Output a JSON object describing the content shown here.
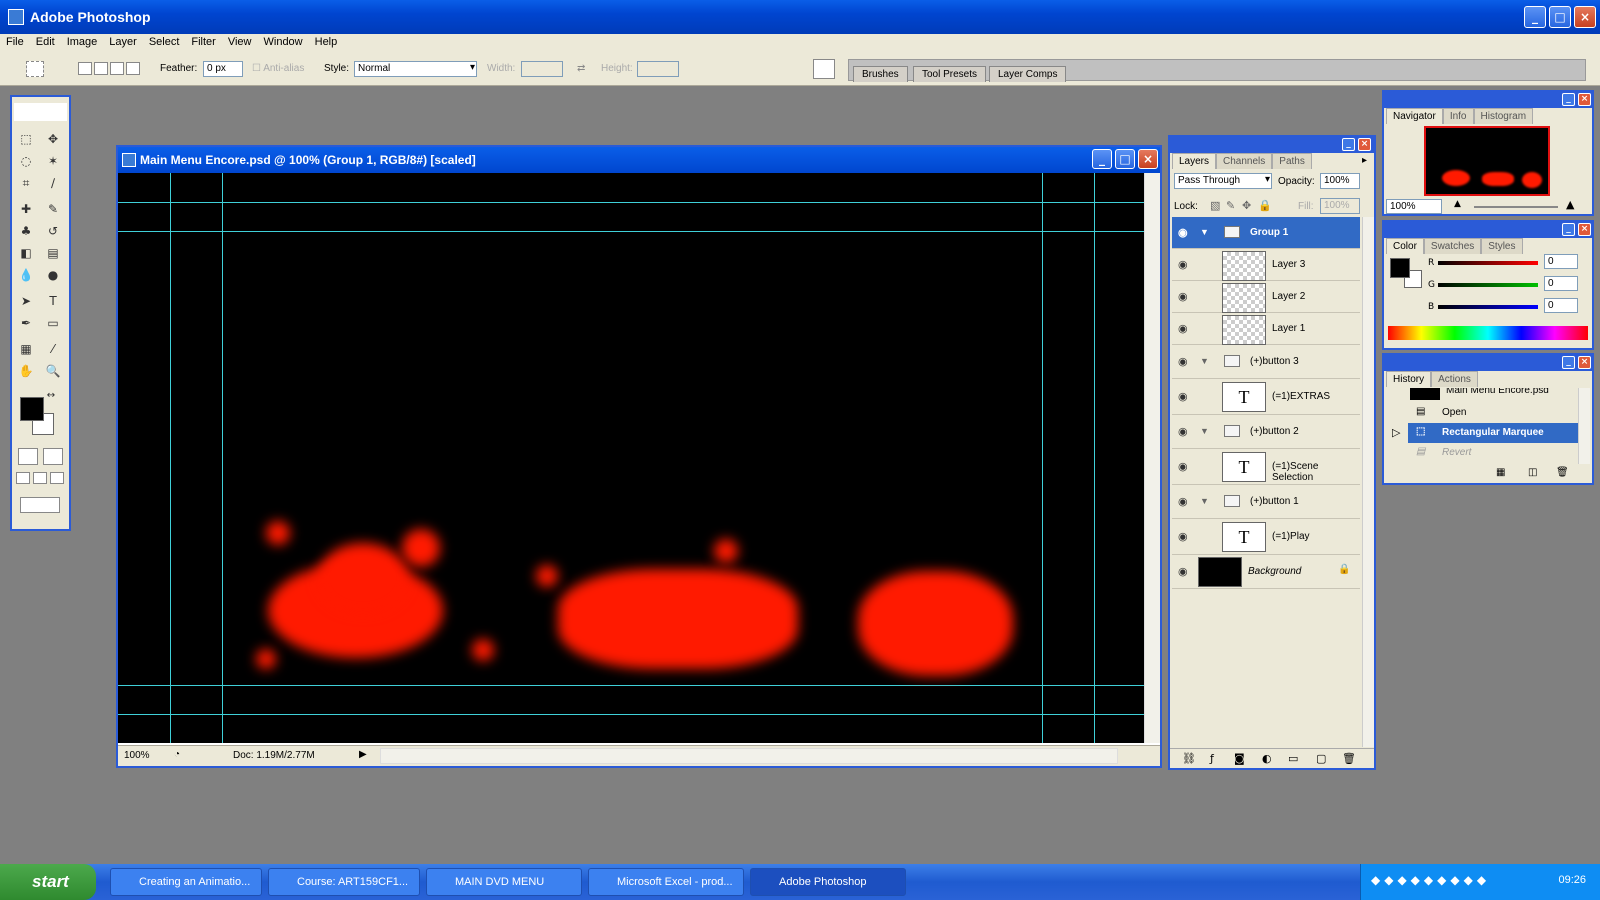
{
  "app": {
    "title": "Adobe Photoshop"
  },
  "menu": [
    "File",
    "Edit",
    "Image",
    "Layer",
    "Select",
    "Filter",
    "View",
    "Window",
    "Help"
  ],
  "options": {
    "feather_label": "Feather:",
    "feather_value": "0 px",
    "antialias_label": "Anti-alias",
    "style_label": "Style:",
    "style_value": "Normal",
    "width_label": "Width:",
    "height_label": "Height:"
  },
  "palette_well": [
    "Brushes",
    "Tool Presets",
    "Layer Comps"
  ],
  "document": {
    "title": "Main Menu Encore.psd @ 100% (Group 1, RGB/8#) [scaled]",
    "zoom": "100%",
    "doc_info": "Doc: 1.19M/2.77M"
  },
  "layers_panel": {
    "tabs": [
      "Layers",
      "Channels",
      "Paths"
    ],
    "blend_mode": "Pass Through",
    "opacity_label": "Opacity:",
    "opacity_value": "100%",
    "lock_label": "Lock:",
    "fill_label": "Fill:",
    "fill_value": "100%",
    "rows": [
      {
        "name": "Group 1",
        "kind": "group",
        "selected": true
      },
      {
        "name": "Layer 3",
        "kind": "layer"
      },
      {
        "name": "Layer 2",
        "kind": "layer"
      },
      {
        "name": "Layer 1",
        "kind": "layer"
      },
      {
        "name": "(+)button 3",
        "kind": "group"
      },
      {
        "name": "(=1)EXTRAS",
        "kind": "text"
      },
      {
        "name": "(+)button 2",
        "kind": "group"
      },
      {
        "name": "(=1)Scene Selection",
        "kind": "text"
      },
      {
        "name": "(+)button 1",
        "kind": "group"
      },
      {
        "name": "(=1)Play",
        "kind": "text"
      },
      {
        "name": "Background",
        "kind": "background"
      }
    ],
    "text_thumb": "T"
  },
  "navigator_panel": {
    "tabs": [
      "Navigator",
      "Info",
      "Histogram"
    ],
    "zoom": "100%"
  },
  "color_panel": {
    "tabs": [
      "Color",
      "Swatches",
      "Styles"
    ],
    "channels": [
      {
        "label": "R",
        "value": "0",
        "color": "#ff0000"
      },
      {
        "label": "G",
        "value": "0",
        "color": "#00c000"
      },
      {
        "label": "B",
        "value": "0",
        "color": "#0000ff"
      }
    ]
  },
  "history_panel": {
    "tabs": [
      "History",
      "Actions"
    ],
    "snapshot": "Main Menu Encore.psd",
    "items": [
      {
        "label": "Open",
        "state": "normal"
      },
      {
        "label": "Rectangular Marquee",
        "state": "selected"
      },
      {
        "label": "Revert",
        "state": "dimmed"
      }
    ]
  },
  "taskbar": {
    "start": "start",
    "buttons": [
      "Creating an Animatio...",
      "Course: ART159CF1...",
      "MAIN DVD MENU",
      "Microsoft Excel - prod...",
      "Adobe Photoshop"
    ],
    "clock": "09:26"
  },
  "colors": {
    "accent": "#2b5bd7",
    "selection": "#316ac5",
    "guide": "#3fd0d8",
    "blob": "#ff1a00"
  }
}
